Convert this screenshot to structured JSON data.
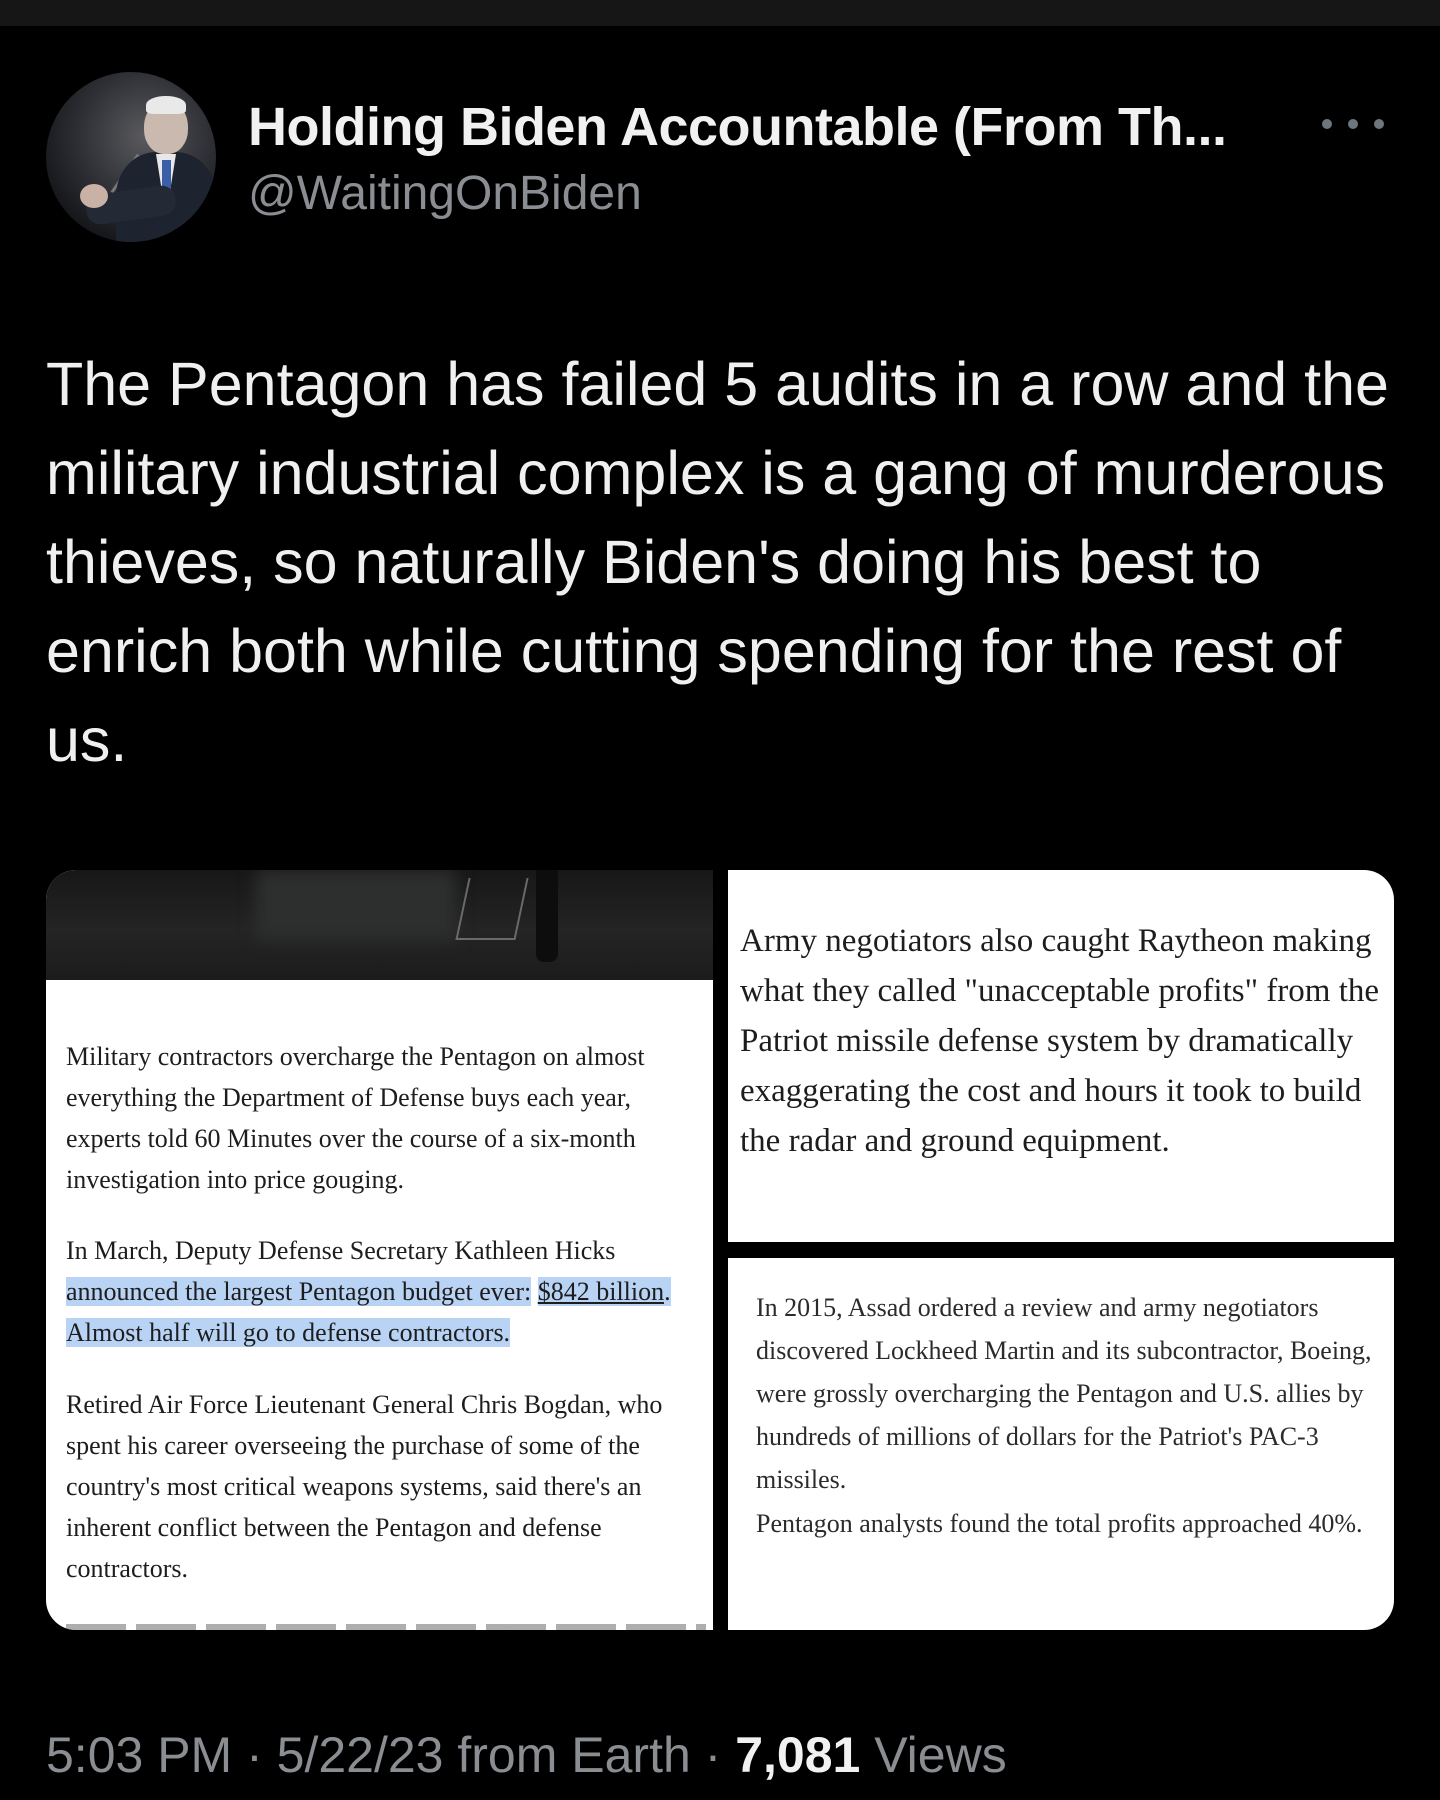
{
  "author": {
    "display_name": "Holding Biden Accountable (From Th...",
    "handle": "@WaitingOnBiden"
  },
  "tweet": {
    "text": "The Pentagon has failed 5 audits in a row and the military industrial complex is a gang of murderous thieves, so naturally Biden's doing his best to enrich both while cutting spending for the rest of us."
  },
  "media": {
    "left": {
      "para1": "Military contractors overcharge the Pentagon on almost everything the Department of Defense buys each year, experts told 60 Minutes over the course of a six-month investigation into price gouging.",
      "para2_before": "In March, Deputy Defense Secretary Kathleen Hicks",
      "para2_highlight_a": "announced the largest Pentagon budget ever:",
      "para2_link": "$842 billion",
      "para2_highlight_b": ". Almost half will go to defense contractors.",
      "para3": "Retired Air Force Lieutenant General Chris Bogdan, who spent his career overseeing the purchase of some of the country's most critical weapons systems, said there's an inherent conflict between the Pentagon and defense contractors."
    },
    "right_top": {
      "text": "Army negotiators also caught Raytheon making what they called \"unacceptable profits\" from the Patriot missile defense system by dramatically exaggerating the cost and hours it took to build the radar and ground equipment."
    },
    "right_bottom": {
      "para1": "In 2015, Assad ordered a review and army negotiators discovered Lockheed Martin and its subcontractor, Boeing, were grossly overcharging the Pentagon and U.S. allies by hundreds of millions of dollars for the Patriot's PAC-3 missiles.",
      "para2": "Pentagon analysts found the total profits approached 40%."
    }
  },
  "meta": {
    "time": "5:03 PM",
    "separator": " · ",
    "date": "5/22/23",
    "source": " from Earth",
    "views_count": "7,081",
    "views_label": " Views"
  },
  "icons": [
    "more-options-icon"
  ]
}
